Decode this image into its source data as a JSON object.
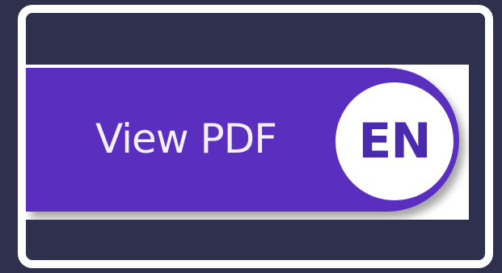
{
  "button": {
    "label": "View PDF",
    "language_badge": "EN"
  },
  "colors": {
    "background": "#2f2f4e",
    "frame_border": "#ffffff",
    "button_fill": "#5a2fc0",
    "button_text": "#f3f0ff",
    "badge_fill": "#ffffff",
    "badge_text": "#4a2bb0"
  },
  "icons": {
    "badge": "language-badge"
  }
}
